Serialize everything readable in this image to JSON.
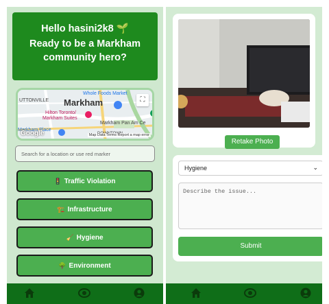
{
  "left": {
    "hero": {
      "line1": "Hello hasini2k8 🌱",
      "line2": "Ready to be a Markham",
      "line3": "community hero?"
    },
    "map": {
      "city": "Markham",
      "labels": [
        "Whole Foods Market",
        "UTTONVILLE",
        "Hilton Toronto/",
        "Markham Suites",
        "Markham Pan Am Ce",
        "Markham Place",
        "DOWNTOWN"
      ],
      "attribution": "Map Data  Terms  Report a map error",
      "google": "Google"
    },
    "search": {
      "placeholder": "Search for a location or use red marker"
    },
    "categories": [
      {
        "icon": "🚦",
        "label": "Traffic Violation"
      },
      {
        "icon": "🏗️",
        "label": "Infrastructure"
      },
      {
        "icon": "🧹",
        "label": "Hygiene"
      },
      {
        "icon": "🌳",
        "label": "Environment"
      }
    ],
    "nav": {
      "icons": [
        "home-icon",
        "report-icon",
        "profile-icon"
      ]
    }
  },
  "right": {
    "photo": {
      "retake_label": "Retake Photo"
    },
    "form": {
      "category_value": "Hygiene",
      "description_placeholder": "Describe the issue...",
      "submit_label": "Submit"
    },
    "nav": {
      "icons": [
        "home-icon",
        "report-icon",
        "profile-icon"
      ]
    }
  },
  "colors": {
    "accent": "#4caf50",
    "hero": "#1e8a1e",
    "nav": "#0f6e18",
    "panel_bg": "#cfe8cf"
  }
}
